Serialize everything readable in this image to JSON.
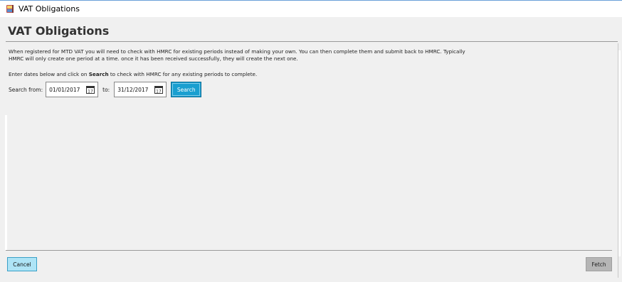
{
  "window": {
    "title": "VAT Obligations",
    "icon": "app-book-icon"
  },
  "page": {
    "title": "VAT Obligations",
    "intro_line1": "When registered for MTD VAT you will need to check with HMRC for existing periods instead of making your own. You can then complete them and submit back to HMRC. Typically",
    "intro_line2": "HMRC will only create one period at a time. once it has been received successfully, they will create the next one.",
    "instructions_pre": "Enter dates below and click on ",
    "instructions_bold": "Search",
    "instructions_post": " to check with HMRC for any existing periods to complete."
  },
  "search": {
    "from_label": "Search from:",
    "from_value": "01/01/2017",
    "to_label": "to:",
    "to_value": "31/12/2017",
    "button_label": "Search",
    "calendar_icon": "calendar-icon"
  },
  "footer": {
    "cancel_label": "Cancel",
    "fetch_label": "Fetch"
  },
  "colors": {
    "accent": "#1a9fd0",
    "cancel_bg": "#aee4f6",
    "fetch_bg": "#b5b5b5",
    "panel_bg": "#f0f0f0"
  }
}
